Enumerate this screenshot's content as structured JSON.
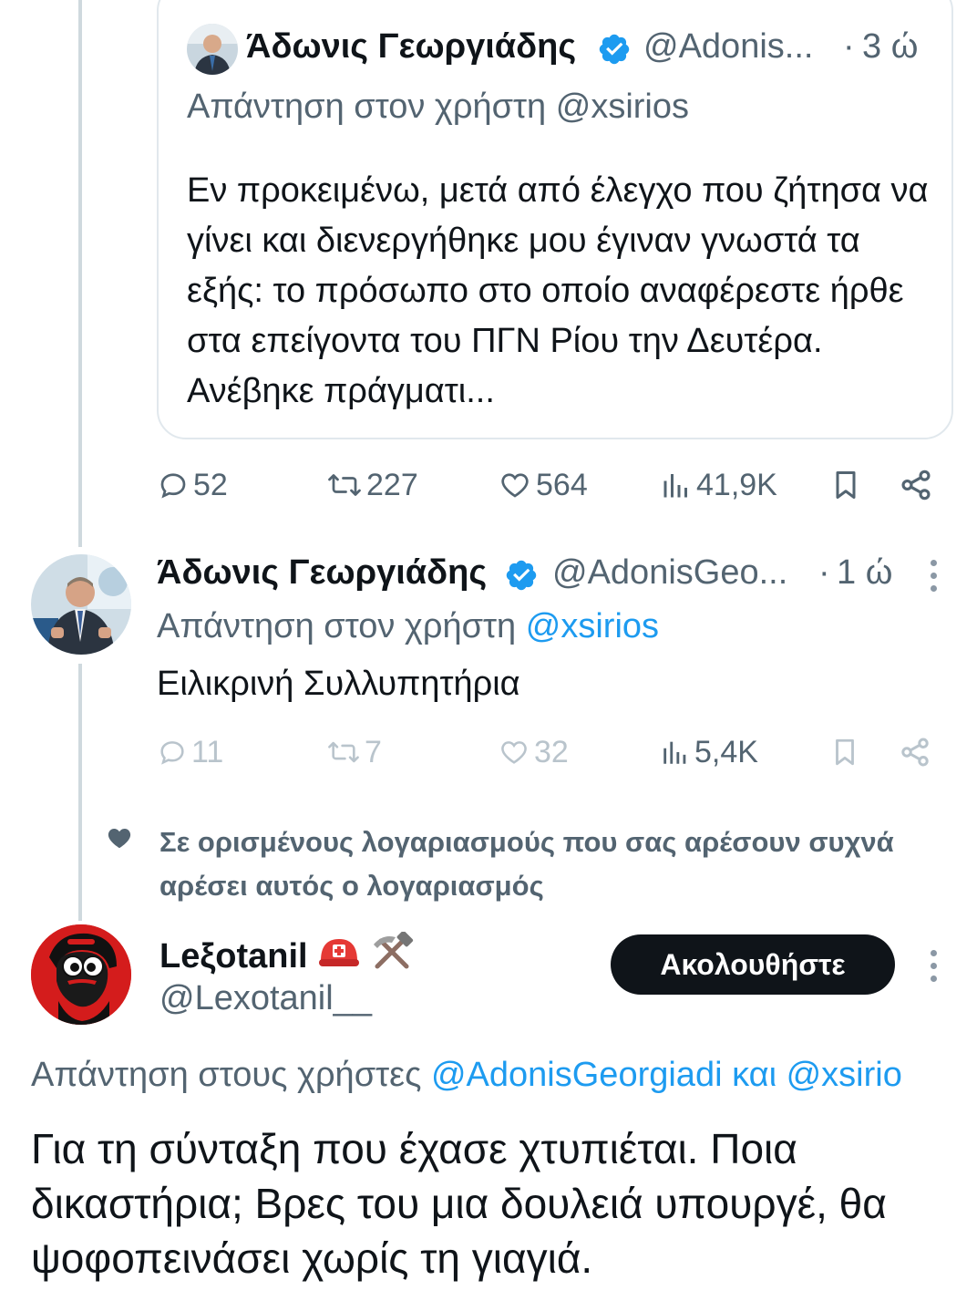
{
  "quoted_tweet": {
    "author_name": "Άδωνις Γεωργιάδης",
    "author_handle": "@Adonis...",
    "dot": "·",
    "time": "3 ώ",
    "replying_to": "Απάντηση στον χρήστη @xsirios",
    "body": "Εν προκειμένω, μετά από έλεγχο που ζήτησα να γίνει και διενεργήθηκε μου έγιναν γνωστά τα εξής: το πρόσωπο στο οποίο αναφέρεστε ήρθε στα επείγοντα του ΠΓΝ Ρίου την Δευτέρα. Ανέβηκε πράγματι..."
  },
  "quoted_actions": {
    "replies": "52",
    "reposts": "227",
    "likes": "564",
    "views": "41,9K"
  },
  "reply_tweet": {
    "author_name": "Άδωνις Γεωργιάδης",
    "author_handle": "@AdonisGeo...",
    "dot": "·",
    "time": "1 ώ",
    "replying_prefix": "Απάντηση στον χρήστη",
    "replying_handle": "@xsirios",
    "body": "Ειλικρινή Συλλυπητήρια"
  },
  "reply_actions": {
    "replies": "11",
    "reposts": "7",
    "likes": "32",
    "views": "5,4K"
  },
  "social_context": {
    "text": "Σε ορισμένους λογαριασμούς που σας αρέσουν συχνά αρέσει αυτός ο λογαριασμός"
  },
  "third_tweet": {
    "author_name": "Leξotanil",
    "author_emoji": "⛑️⚒️",
    "author_handle": "@Lexotanil__",
    "follow_label": "Ακολουθήστε",
    "replying_prefix": "Απάντηση στους χρήστες",
    "replying_handle_1": "@AdonisGeorgiadi",
    "replying_conj": "και",
    "replying_handle_2": "@xsirio",
    "body": "Για τη σύνταξη που έχασε χτυπιέται. Ποια δικαστήρια; Βρες του μια δουλειά υπουργέ, θα ψοφοπεινάσει χωρίς τη γιαγιά."
  },
  "colors": {
    "text": "#0f1419",
    "secondary": "#536471",
    "link": "#1d9bf0",
    "verified": "#1d9bf0",
    "border": "#e1e8ed",
    "thread_line": "#cfd9de"
  }
}
